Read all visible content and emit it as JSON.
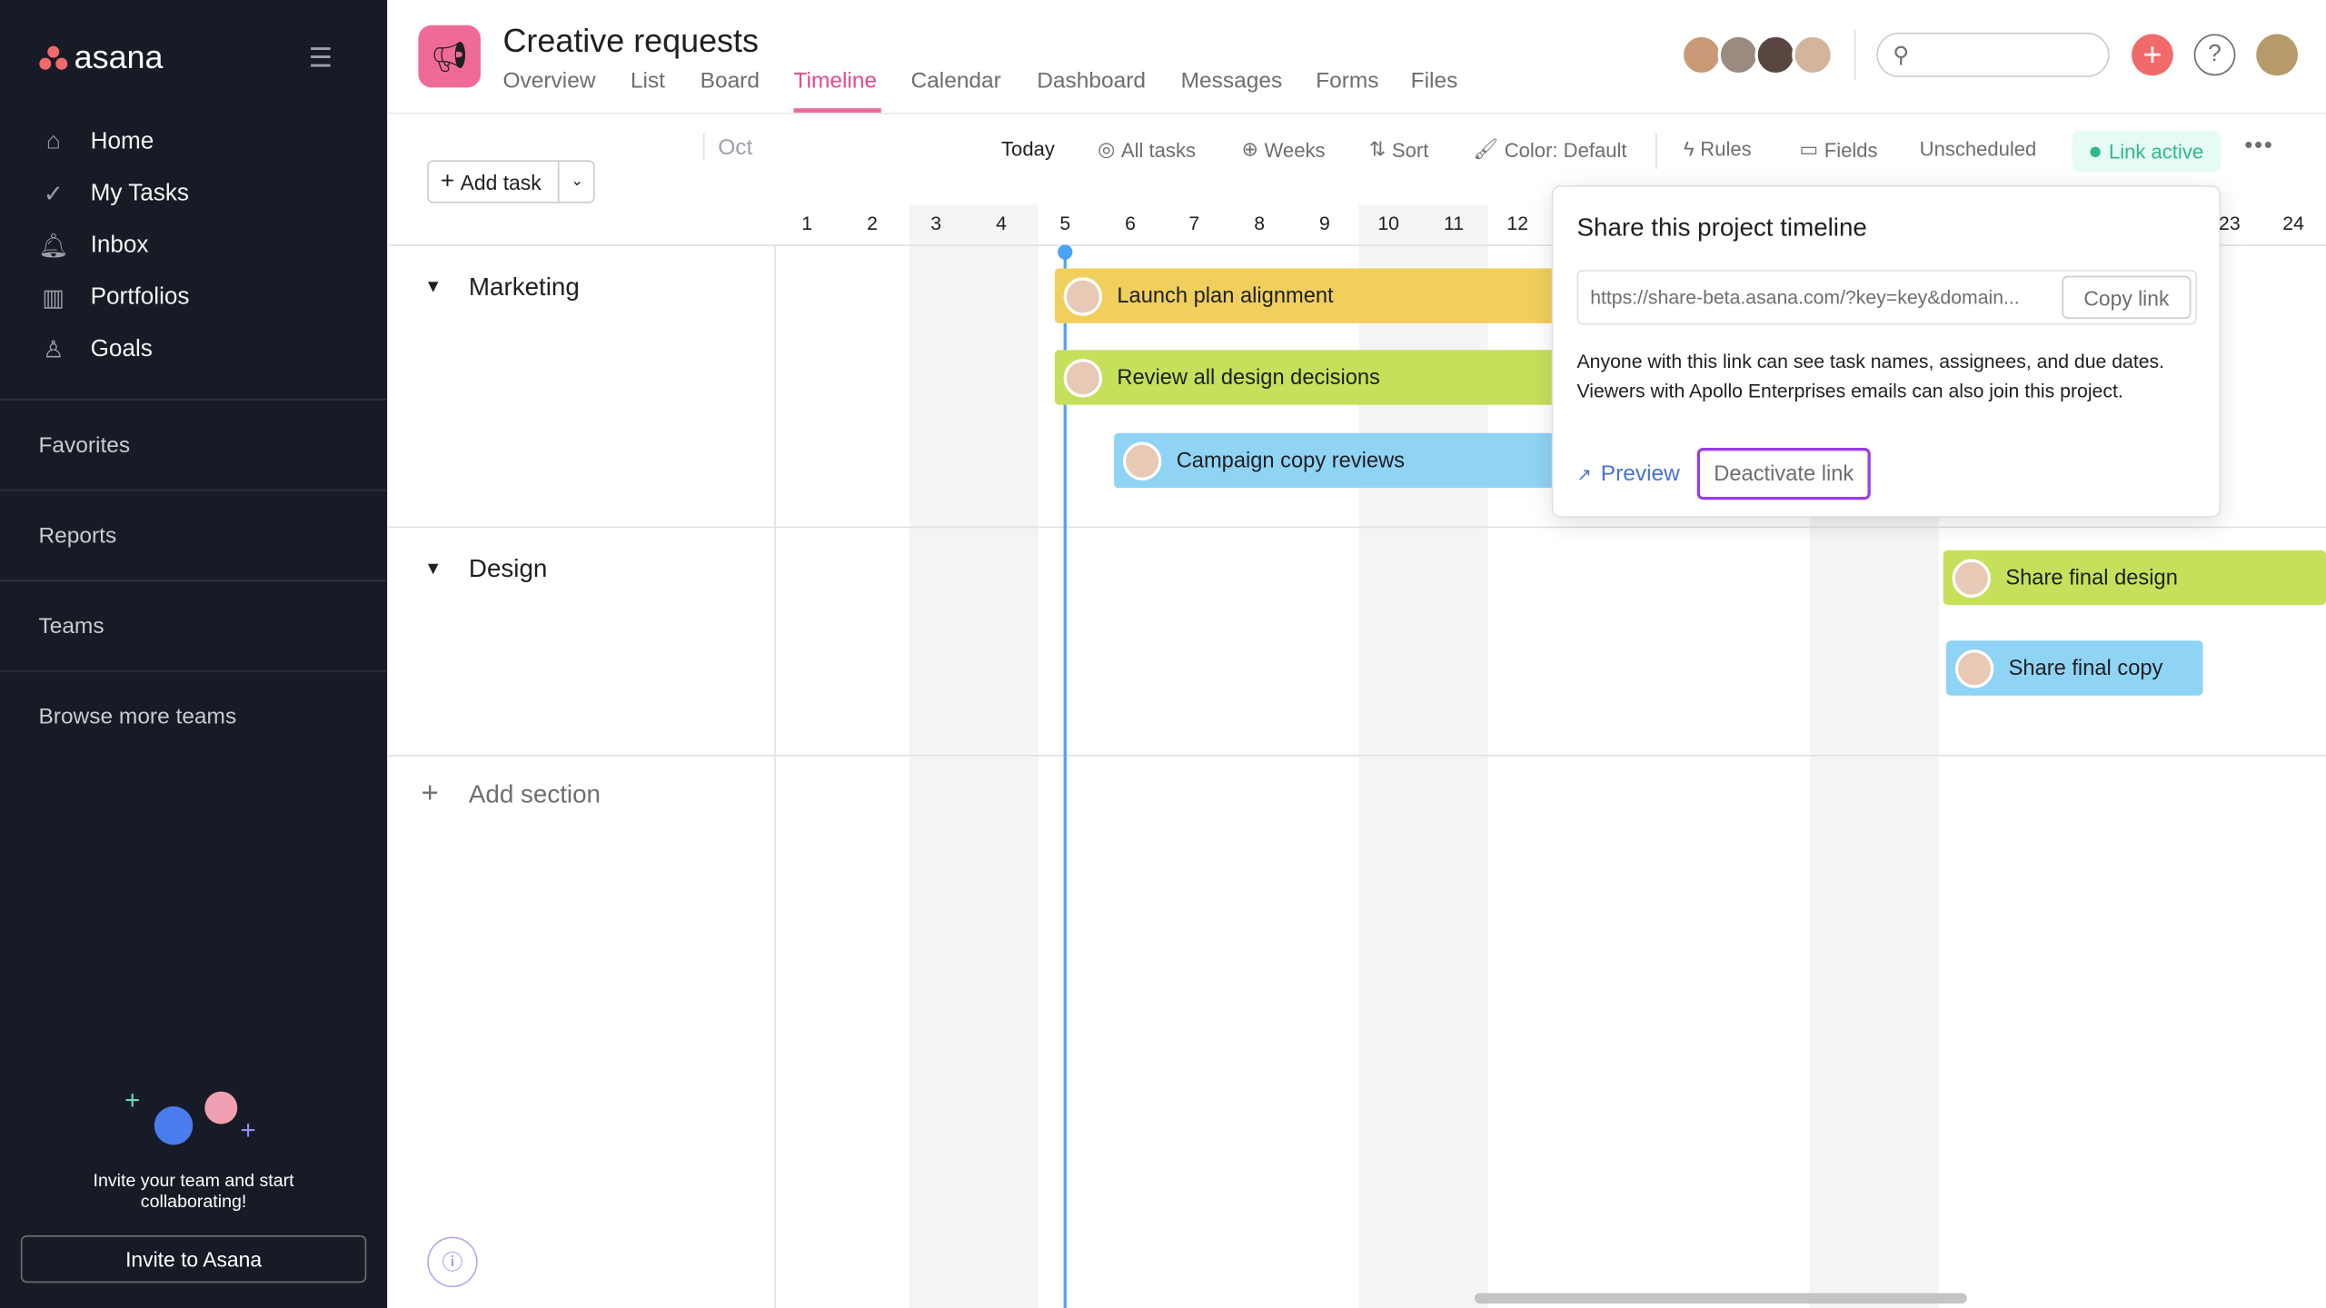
{
  "app": {
    "logo": "asana"
  },
  "sidebar": {
    "items": [
      {
        "label": "Home",
        "icon": "home-icon"
      },
      {
        "label": "My Tasks",
        "icon": "check-circle-icon"
      },
      {
        "label": "Inbox",
        "icon": "bell-icon"
      },
      {
        "label": "Portfolios",
        "icon": "bar-chart-icon"
      },
      {
        "label": "Goals",
        "icon": "person-icon"
      }
    ],
    "sections": [
      "Favorites",
      "Reports",
      "Teams",
      "Browse more teams"
    ],
    "invite_text": "Invite your team and start collaborating!",
    "invite_button": "Invite to Asana"
  },
  "header": {
    "title": "Creative requests",
    "tabs": [
      "Overview",
      "List",
      "Board",
      "Timeline",
      "Calendar",
      "Dashboard",
      "Messages",
      "Forms",
      "Files"
    ],
    "active_tab": "Timeline",
    "search_placeholder": ""
  },
  "toolbar": {
    "add_task": "Add task",
    "month": "Oct",
    "today": "Today",
    "all_tasks": "All tasks",
    "weeks": "Weeks",
    "sort": "Sort",
    "color": "Color: Default",
    "rules": "Rules",
    "fields": "Fields",
    "unscheduled": "Unscheduled",
    "link_active": "Link active"
  },
  "days": [
    "1",
    "2",
    "3",
    "4",
    "5",
    "6",
    "7",
    "8",
    "9",
    "10",
    "11",
    "12",
    "23",
    "24"
  ],
  "sections": [
    {
      "name": "Marketing"
    },
    {
      "name": "Design"
    }
  ],
  "add_section": "Add section",
  "tasks": [
    "Launch plan alignment",
    "Review all design decisions",
    "Campaign copy reviews",
    "Share final design",
    "Share final copy"
  ],
  "popup": {
    "title": "Share this project timeline",
    "url": "https://share-beta.asana.com/?key=key&domain...",
    "copy": "Copy link",
    "description": "Anyone with this link can see task names, assignees, and due dates. Viewers with Apollo Enterprises emails can also join this project.",
    "preview": "Preview",
    "deactivate": "Deactivate link"
  },
  "colors": {
    "accent": "#f06a99",
    "today": "#4ba3f5",
    "yellow": "#f1cf5d",
    "green": "#c7e05b",
    "blue": "#8fd3f5",
    "link_active": "#2fb889",
    "deactivate_border": "#9b3fe0"
  }
}
